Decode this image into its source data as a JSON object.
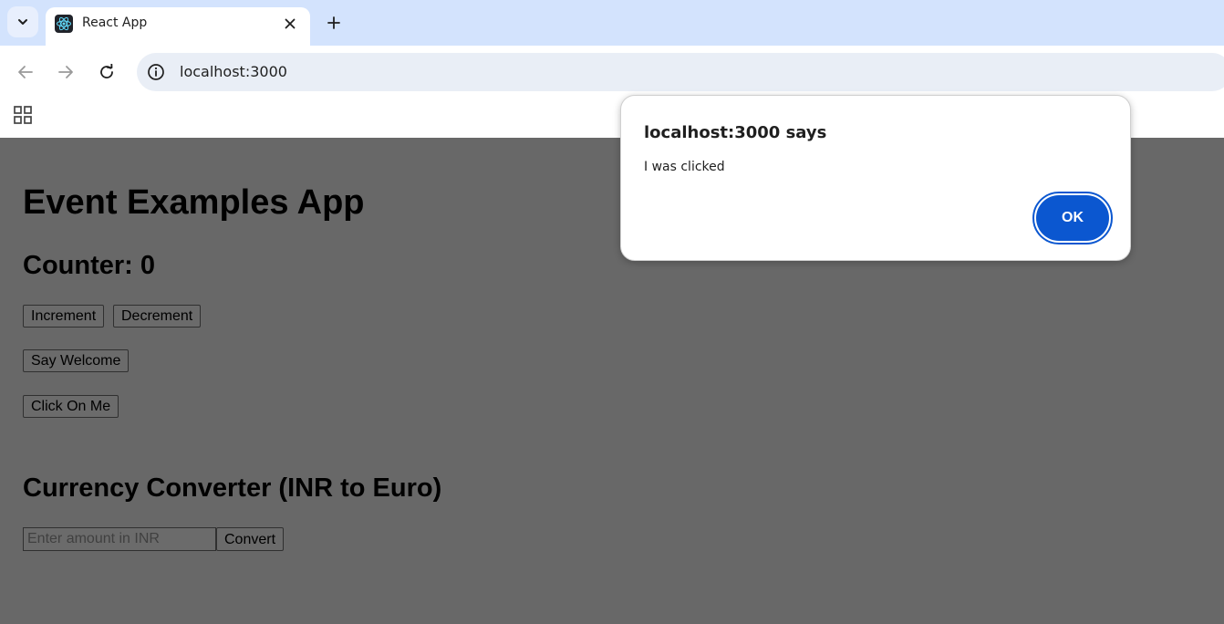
{
  "browser": {
    "tab_title": "React App",
    "url": "localhost:3000"
  },
  "app": {
    "title": "Event Examples App",
    "counter_heading": "Counter: 0",
    "increment_label": "Increment",
    "decrement_label": "Decrement",
    "say_welcome_label": "Say Welcome",
    "click_on_me_label": "Click On Me",
    "converter_heading": "Currency Converter (INR to Euro)",
    "amount_placeholder": "Enter amount in INR",
    "amount_value": "",
    "convert_label": "Convert"
  },
  "dialog": {
    "title": "localhost:3000 says",
    "message": "I was clicked",
    "ok_label": "OK"
  },
  "colors": {
    "tabstrip_bg": "#d3e3fd",
    "page_dimmed_bg": "#686868",
    "ok_button": "#0b57d0"
  },
  "icons": [
    "chevron-down-icon",
    "react-logo-icon",
    "close-icon",
    "plus-icon",
    "back-arrow-icon",
    "forward-arrow-icon",
    "reload-icon",
    "info-icon",
    "apps-grid-icon"
  ]
}
